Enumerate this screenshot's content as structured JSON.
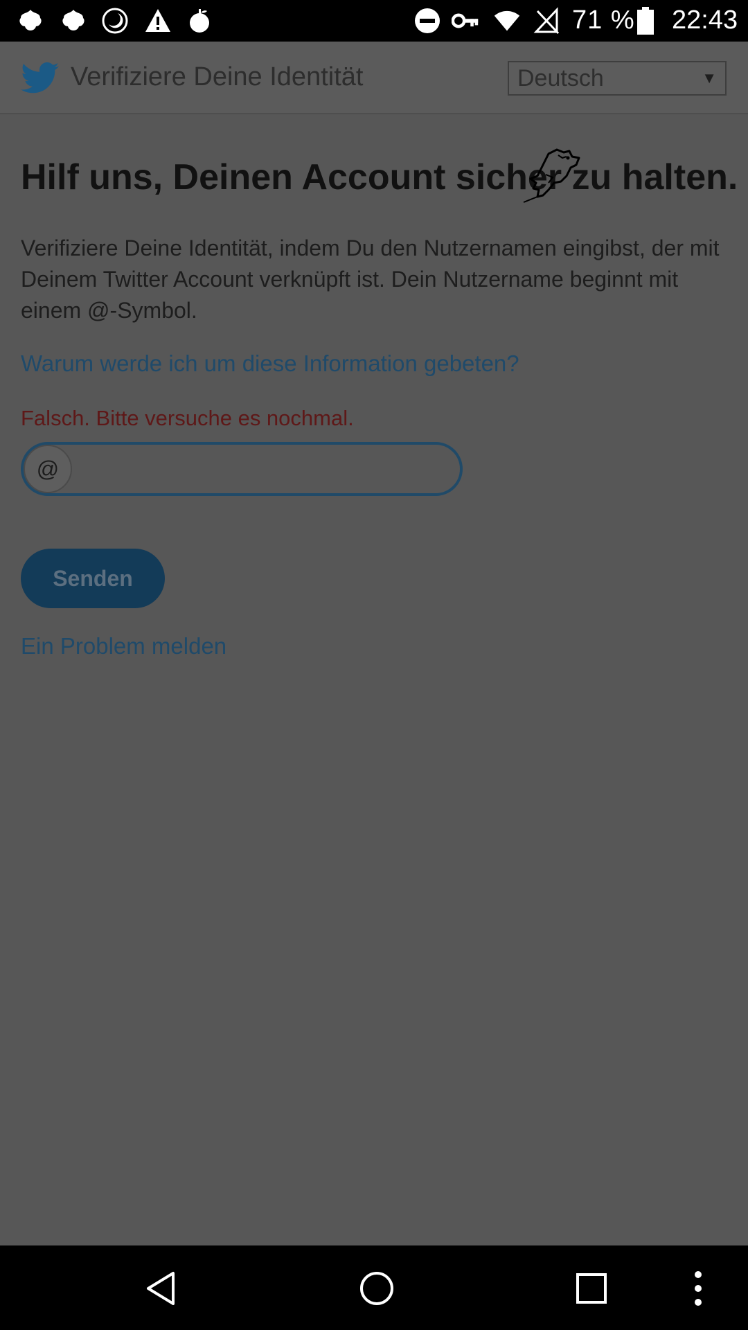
{
  "status_bar": {
    "battery_percent": "71 %",
    "time": "22:43",
    "icons": [
      "notification-icon",
      "notification-icon",
      "moon-icon",
      "warning-icon",
      "apple-icon",
      "do-not-disturb-icon",
      "vpn-key-icon",
      "wifi-icon",
      "no-signal-icon",
      "battery-icon"
    ]
  },
  "header": {
    "logo_icon": "twitter-bird-icon",
    "title": "Verifiziere Deine Identität",
    "language_select": {
      "selected": "Deutsch"
    }
  },
  "main": {
    "headline": "Hilf uns, Deinen Account sicher zu halten.",
    "description": "Verifiziere Deine Identität, indem Du den Nutzernamen eingibst, der mit Deinem Twitter Account verknüpft ist. Dein Nutzername beginnt mit einem @-Symbol.",
    "help_link": "Warum werde ich um diese Information gebeten?",
    "error_message": "Falsch. Bitte versuche es nochmal.",
    "username_field": {
      "prefix": "@",
      "value": ""
    },
    "submit_label": "Senden",
    "report_link": "Ein Problem melden"
  },
  "nav_bar": {
    "icons": [
      "back-icon",
      "home-icon",
      "recents-icon",
      "more-icon"
    ]
  },
  "colors": {
    "overlay_background": "#575757",
    "link": "#1f4a6a",
    "error": "#5e1818",
    "button": "#133b58"
  }
}
